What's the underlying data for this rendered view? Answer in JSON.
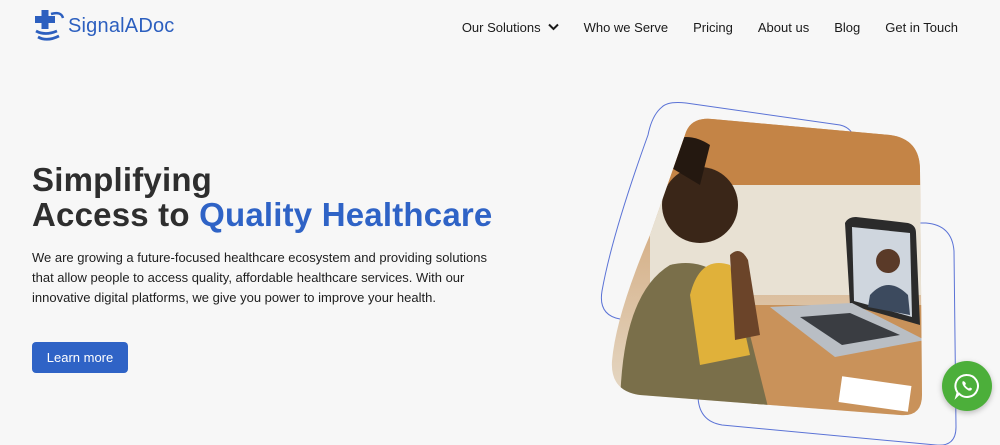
{
  "brand": {
    "name": "SignalADoc",
    "color": "#2c5fbf",
    "logo_icon": "cross-hands-logo-icon"
  },
  "nav": {
    "items": [
      {
        "label": "Our Solutions",
        "has_dropdown": true
      },
      {
        "label": "Who we Serve"
      },
      {
        "label": "Pricing"
      },
      {
        "label": "About us"
      },
      {
        "label": "Blog"
      },
      {
        "label": "Get in Touch"
      }
    ]
  },
  "hero": {
    "title_line1": "Simplifying",
    "title_line2_prefix": "Access to ",
    "title_line2_accent": "Quality Healthcare",
    "description": "We are growing a future-focused healthcare ecosystem and providing solutions that allow people to access quality, affordable healthcare services. With our innovative digital platforms, we give you power to improve your health.",
    "cta_label": "Learn more",
    "accent_color": "#2f63c6"
  },
  "image": {
    "description_icon": "telehealth-video-call-photo"
  },
  "chat": {
    "icon": "whatsapp-icon",
    "color": "#4caf3a"
  }
}
